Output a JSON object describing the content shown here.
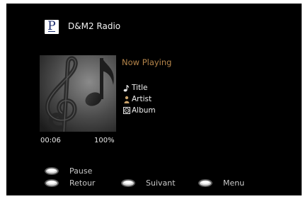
{
  "source": {
    "badge_letter": "P",
    "title": "D&M2 Radio"
  },
  "now_playing": {
    "heading": "Now Playing",
    "title_label": "Title",
    "artist_label": "Artist",
    "album_label": "Album",
    "elapsed_time": "00:06",
    "volume": "100%"
  },
  "hints": [
    {
      "icon": "remote-button-icon",
      "label": "Pause"
    },
    {
      "icon": "remote-button-icon",
      "label": "Retour"
    },
    {
      "icon": "remote-button-icon",
      "label": "Suivant"
    },
    {
      "icon": "remote-button-icon",
      "label": "Menu"
    }
  ],
  "icons": {
    "title": "music-note-icon",
    "artist": "person-icon",
    "album": "disc-icon",
    "artwork": "music-notes-icon"
  },
  "colors": {
    "background": "#000000",
    "accent": "#b5854a",
    "text": "#f0f0f0",
    "hint_text": "#c8c8c8"
  }
}
